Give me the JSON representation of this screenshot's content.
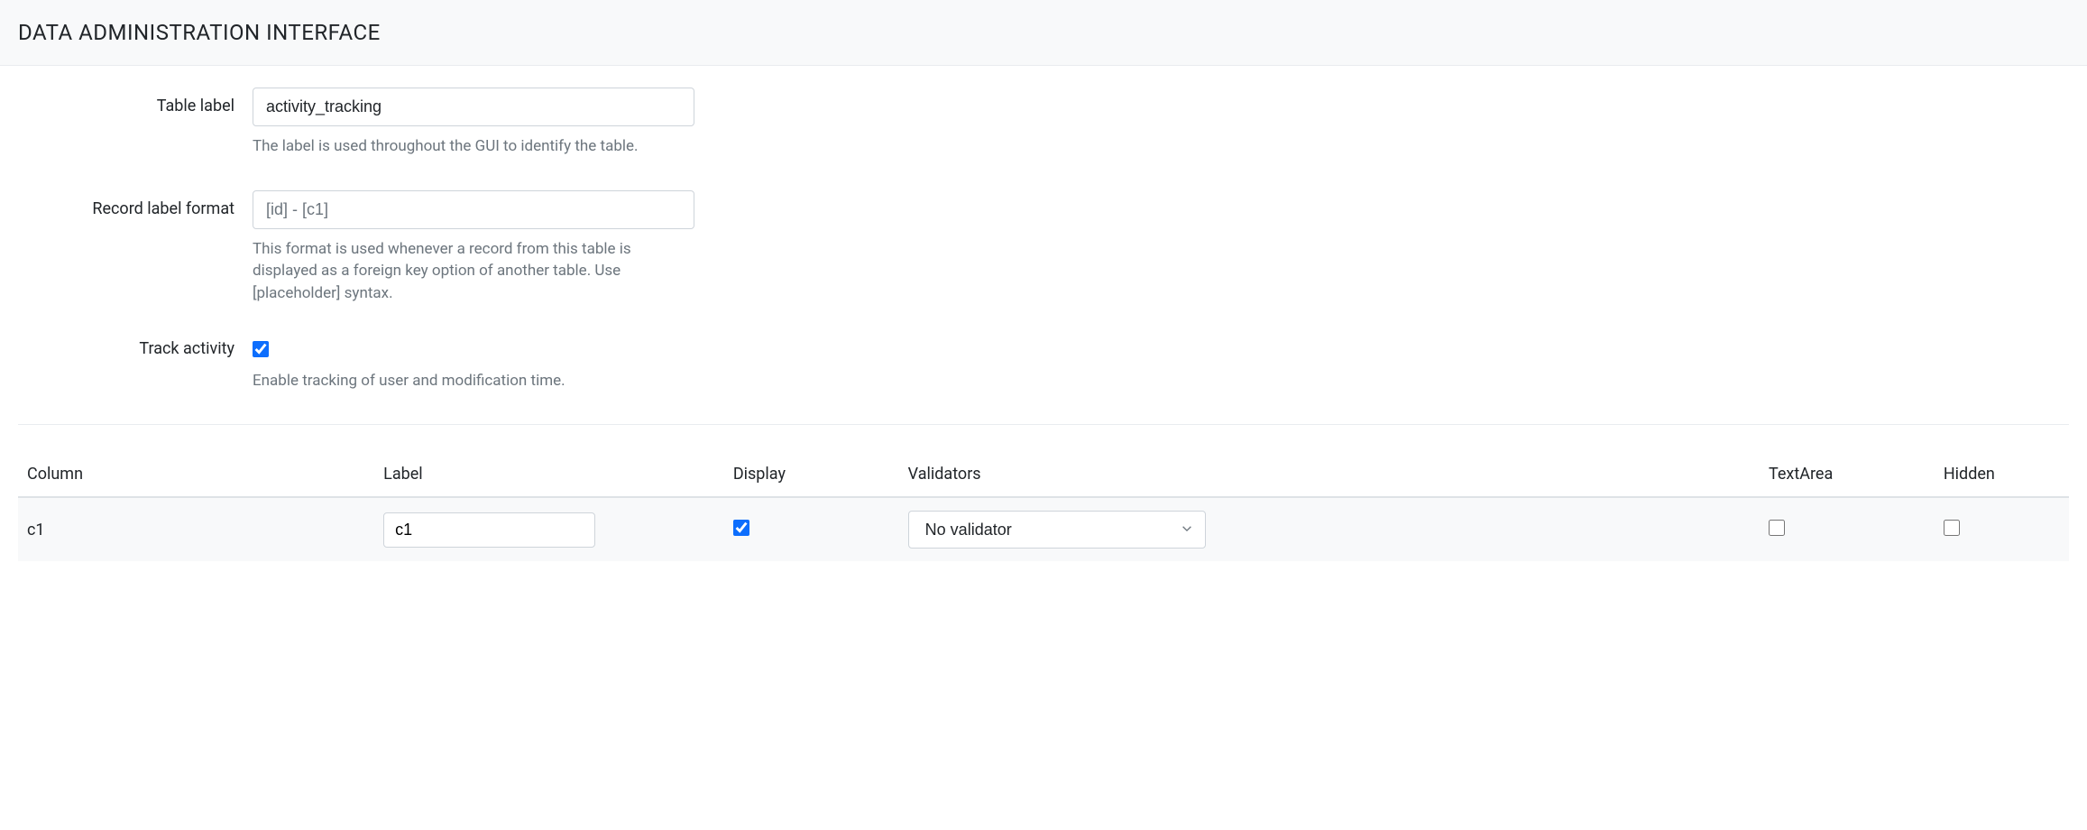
{
  "header": {
    "title": "DATA ADMINISTRATION INTERFACE"
  },
  "form": {
    "table_label": {
      "label": "Table label",
      "value": "activity_tracking",
      "help": "The label is used throughout the GUI to identify the table."
    },
    "record_label_format": {
      "label": "Record label format",
      "placeholder": "[id] - [c1]",
      "value": "",
      "help": "This format is used whenever a record from this table is displayed as a foreign key option of another table. Use [placeholder] syntax."
    },
    "track_activity": {
      "label": "Track activity",
      "checked": true,
      "help": "Enable tracking of user and modification time."
    }
  },
  "columns_table": {
    "headers": {
      "column": "Column",
      "label": "Label",
      "display": "Display",
      "validators": "Validators",
      "textarea": "TextArea",
      "hidden": "Hidden"
    },
    "rows": [
      {
        "column": "c1",
        "label_value": "c1",
        "display_checked": true,
        "validator_selected": "No validator",
        "textarea_checked": false,
        "hidden_checked": false
      }
    ]
  }
}
